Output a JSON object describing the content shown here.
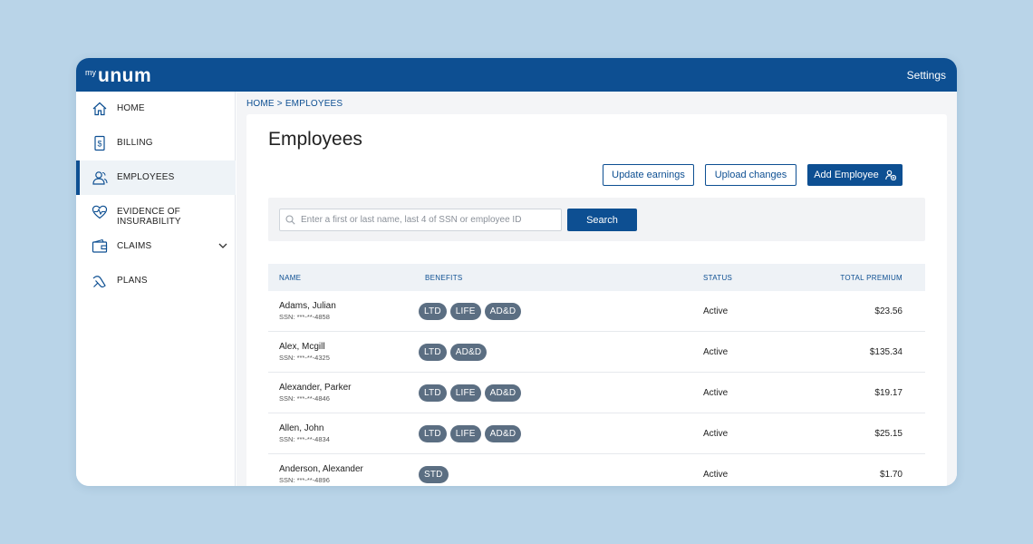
{
  "brand": {
    "prefix": "my",
    "name": "unum"
  },
  "header": {
    "settings_label": "Settings"
  },
  "sidebar": {
    "items": [
      {
        "label": "HOME",
        "icon": "home-icon"
      },
      {
        "label": "BILLING",
        "icon": "billing-icon"
      },
      {
        "label": "EMPLOYEES",
        "icon": "employees-icon",
        "active": true
      },
      {
        "label": "EVIDENCE OF INSURABILITY",
        "icon": "heart-pulse-icon"
      },
      {
        "label": "CLAIMS",
        "icon": "wallet-icon",
        "has_submenu": true
      },
      {
        "label": "PLANS",
        "icon": "plans-icon"
      }
    ]
  },
  "breadcrumb": {
    "home": "HOME",
    "separator": " > ",
    "current": "EMPLOYEES"
  },
  "page": {
    "title": "Employees"
  },
  "actions": {
    "update_earnings": "Update earnings",
    "upload_changes": "Upload changes",
    "add_employee": "Add Employee"
  },
  "search": {
    "placeholder": "Enter a first or last name, last 4 of SSN or employee ID",
    "value": "",
    "button_label": "Search"
  },
  "table": {
    "columns": {
      "name": "NAME",
      "benefits": "BENEFITS",
      "status": "STATUS",
      "premium": "TOTAL PREMIUM"
    },
    "rows": [
      {
        "name": "Adams, Julian",
        "ssn": "SSN: ***-**-4858",
        "benefits": [
          "LTD",
          "LIFE",
          "AD&D"
        ],
        "status": "Active",
        "premium": "$23.56"
      },
      {
        "name": "Alex, Mcgill",
        "ssn": "SSN: ***-**-4325",
        "benefits": [
          "LTD",
          "AD&D"
        ],
        "status": "Active",
        "premium": "$135.34"
      },
      {
        "name": "Alexander, Parker",
        "ssn": "SSN: ***-**-4846",
        "benefits": [
          "LTD",
          "LIFE",
          "AD&D"
        ],
        "status": "Active",
        "premium": "$19.17"
      },
      {
        "name": "Allen, John",
        "ssn": "SSN: ***-**-4834",
        "benefits": [
          "LTD",
          "LIFE",
          "AD&D"
        ],
        "status": "Active",
        "premium": "$25.15"
      },
      {
        "name": "Anderson, Alexander",
        "ssn": "SSN: ***-**-4896",
        "benefits": [
          "STD"
        ],
        "status": "Active",
        "premium": "$1.70"
      }
    ]
  },
  "colors": {
    "brand_blue": "#0d4f92",
    "chip": "#5b6e82",
    "background": "#b9d4e8"
  }
}
